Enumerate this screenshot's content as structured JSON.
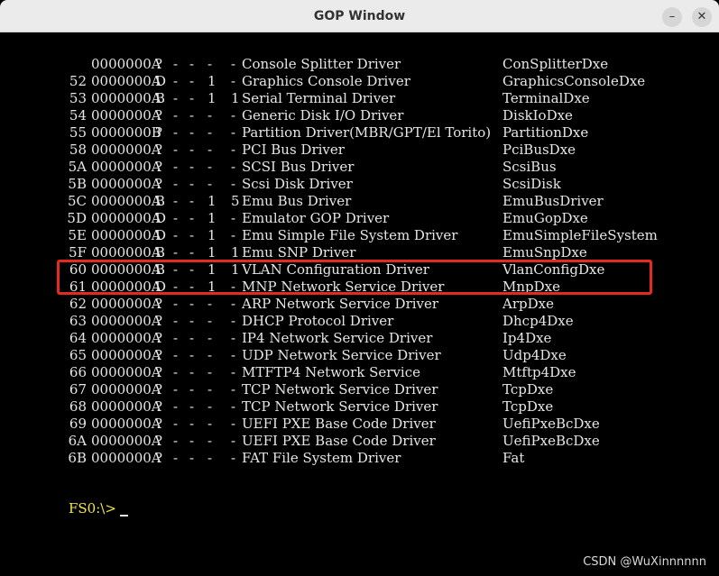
{
  "window": {
    "title": "GOP Window",
    "minimize_label": "–",
    "close_label": "✕"
  },
  "drivers": [
    {
      "id": "",
      "version": "0000000A",
      "type": "?",
      "flag1": "-",
      "flag2": "-",
      "cfg": "-",
      "diag": "-",
      "name": "Console Splitter Driver",
      "image": "ConSplitterDxe"
    },
    {
      "id": "52",
      "version": "0000000A",
      "type": "D",
      "flag1": "-",
      "flag2": "-",
      "cfg": "1",
      "diag": "-",
      "name": "Graphics Console Driver",
      "image": "GraphicsConsoleDxe"
    },
    {
      "id": "53",
      "version": "0000000A",
      "type": "B",
      "flag1": "-",
      "flag2": "-",
      "cfg": "1",
      "diag": "1",
      "name": "Serial Terminal Driver",
      "image": "TerminalDxe"
    },
    {
      "id": "54",
      "version": "0000000A",
      "type": "?",
      "flag1": "-",
      "flag2": "-",
      "cfg": "-",
      "diag": "-",
      "name": "Generic Disk I/O Driver",
      "image": "DiskIoDxe"
    },
    {
      "id": "55",
      "version": "0000000B",
      "type": "?",
      "flag1": "-",
      "flag2": "-",
      "cfg": "-",
      "diag": "-",
      "name": "Partition Driver(MBR/GPT/El Torito)",
      "image": "PartitionDxe"
    },
    {
      "id": "58",
      "version": "0000000A",
      "type": "?",
      "flag1": "-",
      "flag2": "-",
      "cfg": "-",
      "diag": "-",
      "name": "PCI Bus Driver",
      "image": "PciBusDxe"
    },
    {
      "id": "5A",
      "version": "0000000A",
      "type": "?",
      "flag1": "-",
      "flag2": "-",
      "cfg": "-",
      "diag": "-",
      "name": "SCSI Bus Driver",
      "image": "ScsiBus"
    },
    {
      "id": "5B",
      "version": "0000000A",
      "type": "?",
      "flag1": "-",
      "flag2": "-",
      "cfg": "-",
      "diag": "-",
      "name": "Scsi Disk Driver",
      "image": "ScsiDisk"
    },
    {
      "id": "5C",
      "version": "0000000A",
      "type": "B",
      "flag1": "-",
      "flag2": "-",
      "cfg": "1",
      "diag": "5",
      "name": "Emu Bus Driver",
      "image": "EmuBusDriver"
    },
    {
      "id": "5D",
      "version": "0000000A",
      "type": "D",
      "flag1": "-",
      "flag2": "-",
      "cfg": "1",
      "diag": "-",
      "name": "Emulator GOP Driver",
      "image": "EmuGopDxe"
    },
    {
      "id": "5E",
      "version": "0000000A",
      "type": "D",
      "flag1": "-",
      "flag2": "-",
      "cfg": "1",
      "diag": "-",
      "name": "Emu Simple File System Driver",
      "image": "EmuSimpleFileSystem"
    },
    {
      "id": "5F",
      "version": "0000000A",
      "type": "B",
      "flag1": "-",
      "flag2": "-",
      "cfg": "1",
      "diag": "1",
      "name": "Emu SNP Driver",
      "image": "EmuSnpDxe"
    },
    {
      "id": "60",
      "version": "0000000A",
      "type": "B",
      "flag1": "-",
      "flag2": "-",
      "cfg": "1",
      "diag": "1",
      "name": "VLAN Configuration Driver",
      "image": "VlanConfigDxe"
    },
    {
      "id": "61",
      "version": "0000000A",
      "type": "D",
      "flag1": "-",
      "flag2": "-",
      "cfg": "1",
      "diag": "-",
      "name": "MNP Network Service Driver",
      "image": "MnpDxe"
    },
    {
      "id": "62",
      "version": "0000000A",
      "type": "?",
      "flag1": "-",
      "flag2": "-",
      "cfg": "-",
      "diag": "-",
      "name": "ARP Network Service Driver",
      "image": "ArpDxe"
    },
    {
      "id": "63",
      "version": "0000000A",
      "type": "?",
      "flag1": "-",
      "flag2": "-",
      "cfg": "-",
      "diag": "-",
      "name": "DHCP Protocol Driver",
      "image": "Dhcp4Dxe"
    },
    {
      "id": "64",
      "version": "0000000A",
      "type": "?",
      "flag1": "-",
      "flag2": "-",
      "cfg": "-",
      "diag": "-",
      "name": "IP4 Network Service Driver",
      "image": "Ip4Dxe"
    },
    {
      "id": "65",
      "version": "0000000A",
      "type": "?",
      "flag1": "-",
      "flag2": "-",
      "cfg": "-",
      "diag": "-",
      "name": "UDP Network Service Driver",
      "image": "Udp4Dxe"
    },
    {
      "id": "66",
      "version": "0000000A",
      "type": "?",
      "flag1": "-",
      "flag2": "-",
      "cfg": "-",
      "diag": "-",
      "name": "MTFTP4 Network Service",
      "image": "Mtftp4Dxe"
    },
    {
      "id": "67",
      "version": "0000000A",
      "type": "?",
      "flag1": "-",
      "flag2": "-",
      "cfg": "-",
      "diag": "-",
      "name": "TCP Network Service Driver",
      "image": "TcpDxe"
    },
    {
      "id": "68",
      "version": "0000000A",
      "type": "?",
      "flag1": "-",
      "flag2": "-",
      "cfg": "-",
      "diag": "-",
      "name": "TCP Network Service Driver",
      "image": "TcpDxe"
    },
    {
      "id": "69",
      "version": "0000000A",
      "type": "?",
      "flag1": "-",
      "flag2": "-",
      "cfg": "-",
      "diag": "-",
      "name": "UEFI PXE Base Code Driver",
      "image": "UefiPxeBcDxe"
    },
    {
      "id": "6A",
      "version": "0000000A",
      "type": "?",
      "flag1": "-",
      "flag2": "-",
      "cfg": "-",
      "diag": "-",
      "name": "UEFI PXE Base Code Driver",
      "image": "UefiPxeBcDxe"
    },
    {
      "id": "6B",
      "version": "0000000A",
      "type": "?",
      "flag1": "-",
      "flag2": "-",
      "cfg": "-",
      "diag": "-",
      "name": "FAT File System Driver",
      "image": "Fat"
    }
  ],
  "highlight_color": "#e52b21",
  "prompt": "FS0:\\>",
  "watermark": "CSDN @WuXinnnnnn"
}
